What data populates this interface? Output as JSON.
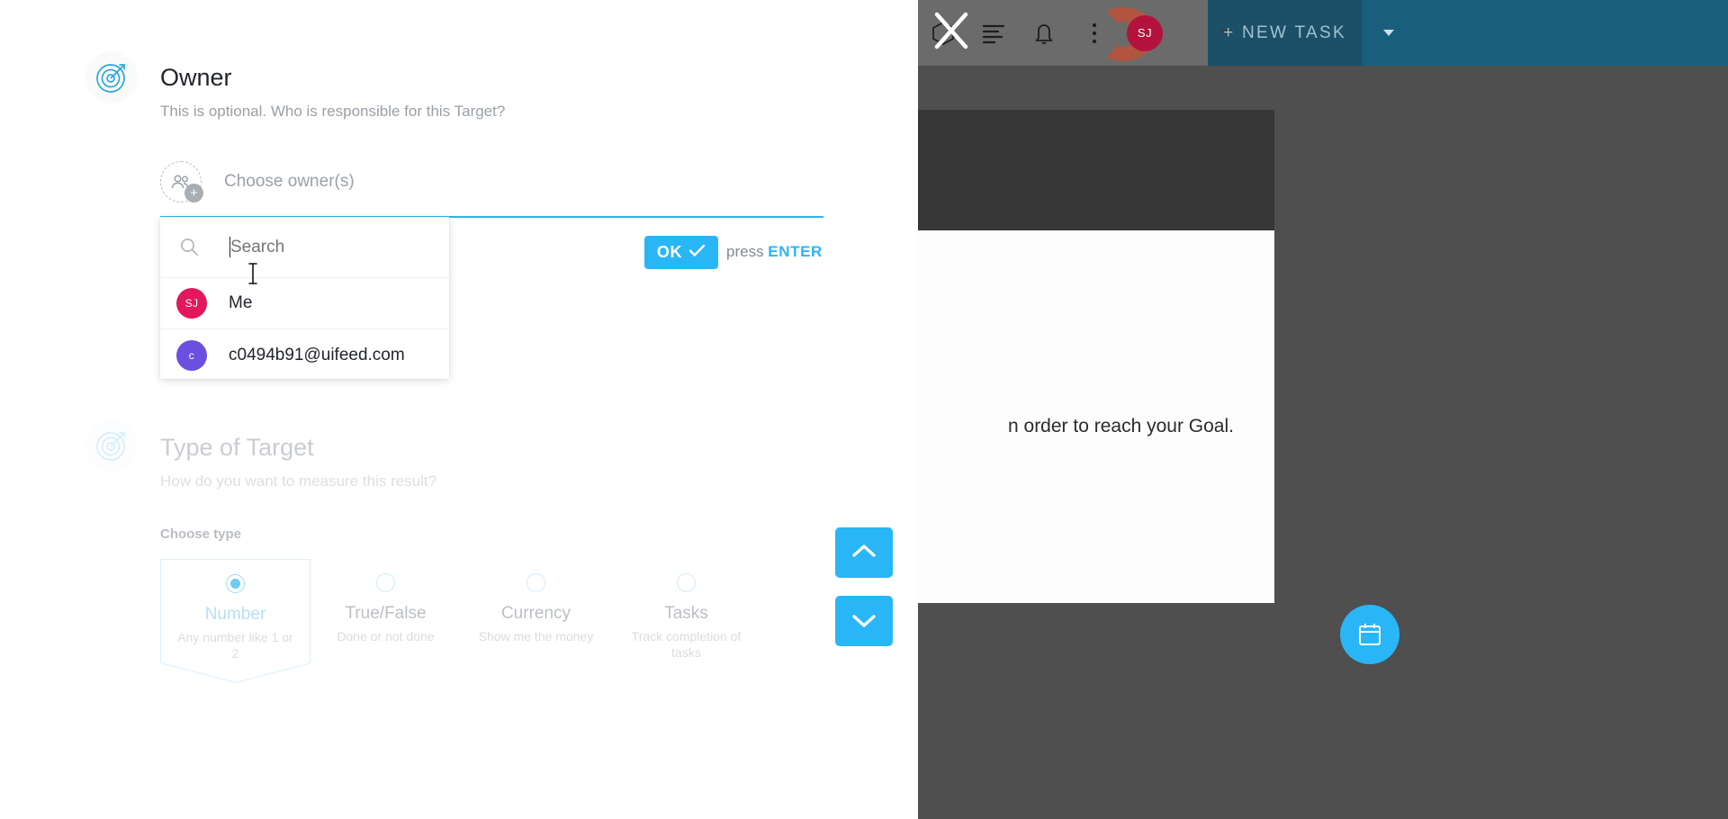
{
  "background": {
    "topbar": {
      "icons": [
        "cube-icon",
        "close-icon",
        "list-icon",
        "bell-icon",
        "kebab-menu-icon"
      ],
      "avatar_initials": "SJ",
      "new_task_label": "+ NEW TASK"
    },
    "goal_text": "n order to reach your Goal.",
    "fab_icon": "calendar-icon"
  },
  "modal": {
    "owner_section": {
      "icon": "target-icon",
      "title": "Owner",
      "subtitle": "This is optional. Who is responsible for this Target?",
      "chooser_placeholder": "Choose owner(s)",
      "add_icon": "add-people-icon"
    },
    "dropdown": {
      "search_placeholder": "Search",
      "search_value": "",
      "search_icon": "search-icon",
      "items": [
        {
          "initials": "SJ",
          "label": "Me",
          "color": "#e3175c"
        },
        {
          "initials": "c",
          "label": "c0494b91@uifeed.com",
          "color": "#6b4fe0"
        }
      ]
    },
    "confirm": {
      "ok_label": "OK",
      "check_icon": "check-icon",
      "hint_prefix": "press ",
      "hint_key": "ENTER"
    },
    "type_section": {
      "icon": "target-icon",
      "title": "Type of Target",
      "subtitle": "How do you want to measure this result?",
      "choose_label": "Choose type",
      "options": [
        {
          "name": "Number",
          "desc": "Any number like 1 or 2",
          "selected": true
        },
        {
          "name": "True/False",
          "desc": "Done or not done",
          "selected": false
        },
        {
          "name": "Currency",
          "desc": "Show me the money",
          "selected": false
        },
        {
          "name": "Tasks",
          "desc": "Track completion of tasks",
          "selected": false
        }
      ]
    },
    "scroll": {
      "up_icon": "chevron-up-icon",
      "down_icon": "chevron-down-icon"
    }
  },
  "colors": {
    "accent": "#29b6f6",
    "underline": "#33b3e8",
    "avatar_me": "#e3175c",
    "avatar_other": "#6b4fe0",
    "brand_dark": "#1a5e7e"
  }
}
